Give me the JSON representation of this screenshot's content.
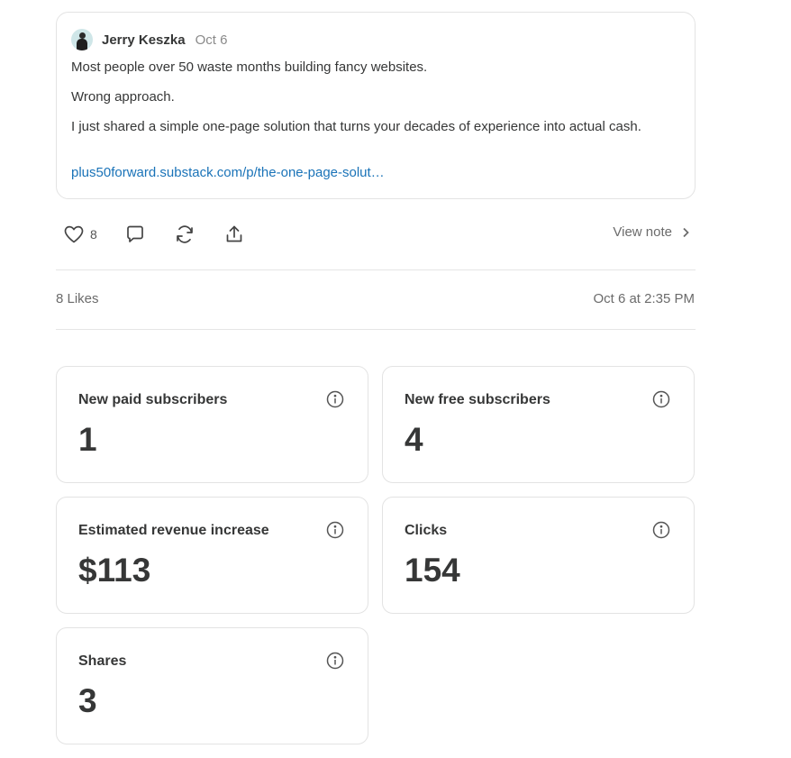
{
  "note": {
    "author": "Jerry Keszka",
    "date": "Oct 6",
    "paragraphs": [
      "Most people over 50 waste months building fancy websites.",
      "Wrong approach.",
      "I just shared a simple one-page solution that turns your decades of experience into actual cash."
    ],
    "link_text": "plus50forward.substack.com/p/the-one-page-solut…"
  },
  "actions": {
    "like_count": "8",
    "view_note_label": "View note"
  },
  "meta": {
    "likes_label": "8 Likes",
    "timestamp": "Oct 6 at 2:35 PM"
  },
  "stats": [
    {
      "label": "New paid subscribers",
      "value": "1"
    },
    {
      "label": "New free subscribers",
      "value": "4"
    },
    {
      "label": "Estimated revenue increase",
      "value": "$113"
    },
    {
      "label": "Clicks",
      "value": "154"
    },
    {
      "label": "Shares",
      "value": "3"
    }
  ],
  "icons": {
    "like": "heart-icon",
    "comment": "comment-icon",
    "restack": "restack-icon",
    "share": "share-icon",
    "chevron": "chevron-right-icon",
    "info": "info-icon"
  },
  "colors": {
    "link": "#1a73b8",
    "text": "#363737",
    "muted": "#6b6b6b",
    "border": "#e3e3e3"
  }
}
